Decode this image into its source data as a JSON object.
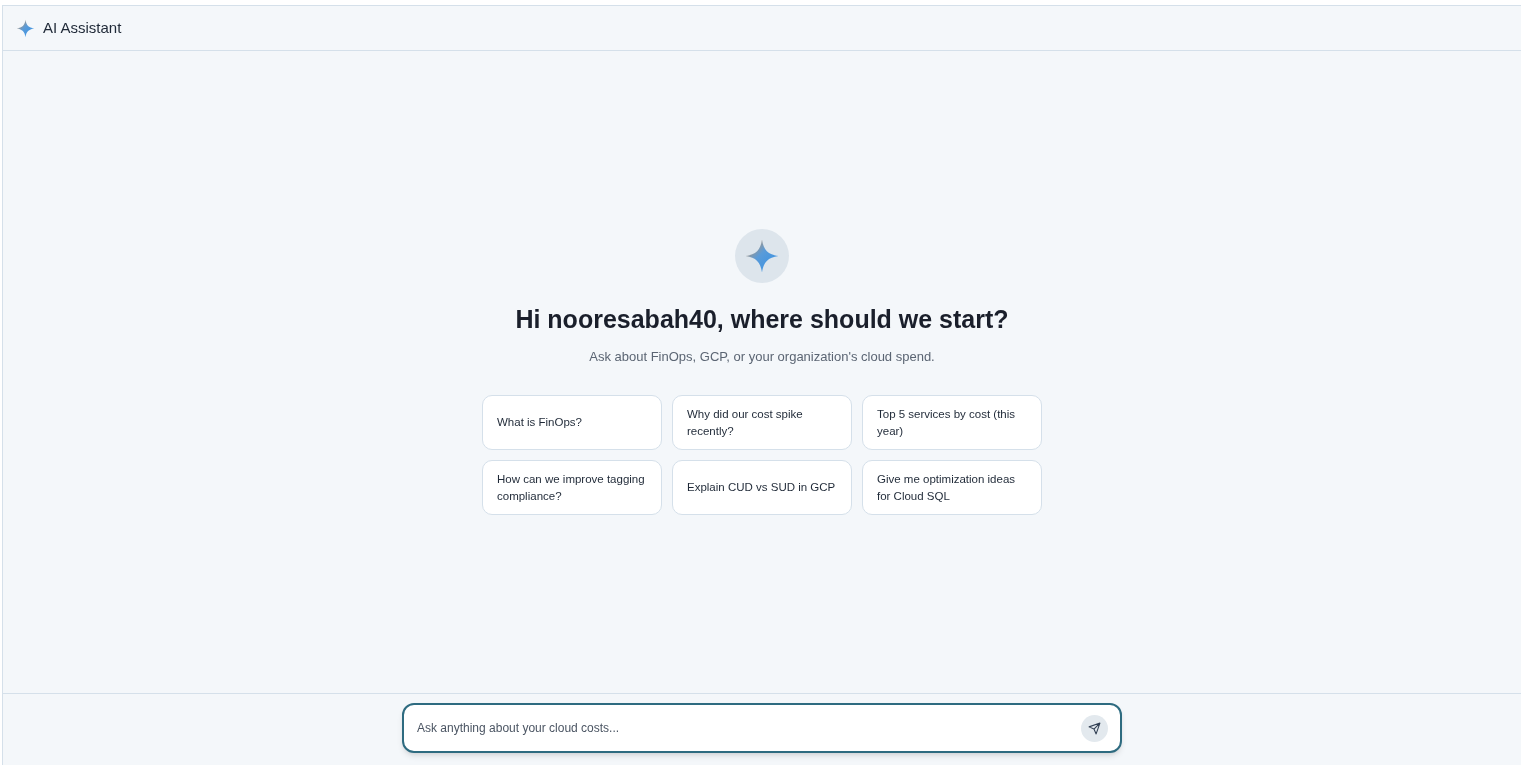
{
  "header": {
    "title": "AI Assistant"
  },
  "welcome": {
    "heading": "Hi nooresabah40, where should we start?",
    "subtitle": "Ask about FinOps, GCP, or your organization's cloud spend."
  },
  "suggestions": [
    {
      "text": "What is FinOps?"
    },
    {
      "text": "Why did our cost spike recently?"
    },
    {
      "text": "Top 5 services by cost (this year)"
    },
    {
      "text": "How can we improve tagging compliance?"
    },
    {
      "text": "Explain CUD vs SUD in GCP"
    },
    {
      "text": "Give me optimization ideas for Cloud SQL"
    }
  ],
  "composer": {
    "placeholder": "Ask anything about your cloud costs..."
  }
}
